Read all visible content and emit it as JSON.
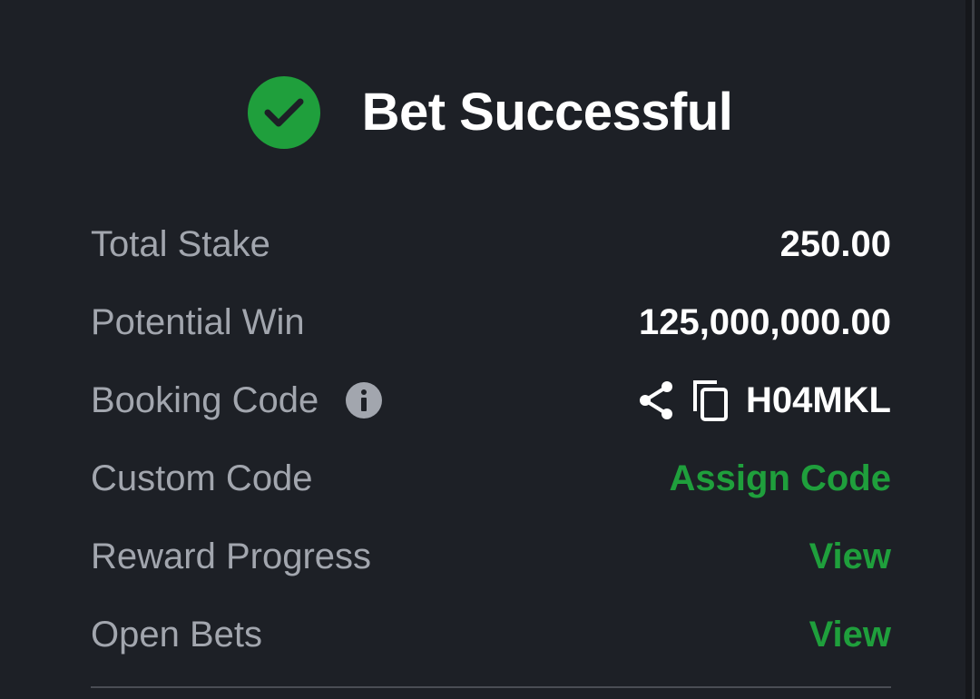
{
  "header": {
    "title": "Bet Successful",
    "icon": "check-circle-icon",
    "accent_color": "#1f9f3c"
  },
  "rows": {
    "total_stake": {
      "label": "Total Stake",
      "value": "250.00"
    },
    "potential_win": {
      "label": "Potential Win",
      "value": "125,000,000.00"
    },
    "booking_code": {
      "label": "Booking Code",
      "value": "H04MKL",
      "label_icon": "info-icon",
      "action_icons": [
        "share-icon",
        "copy-icon"
      ]
    },
    "custom_code": {
      "label": "Custom Code",
      "link": "Assign Code"
    },
    "reward_progress": {
      "label": "Reward Progress",
      "link": "View"
    },
    "open_bets": {
      "label": "Open Bets",
      "link": "View"
    }
  },
  "colors": {
    "background": "#1d2026",
    "label": "#a2a6ae",
    "value": "#ffffff",
    "link": "#1f9f3c"
  }
}
